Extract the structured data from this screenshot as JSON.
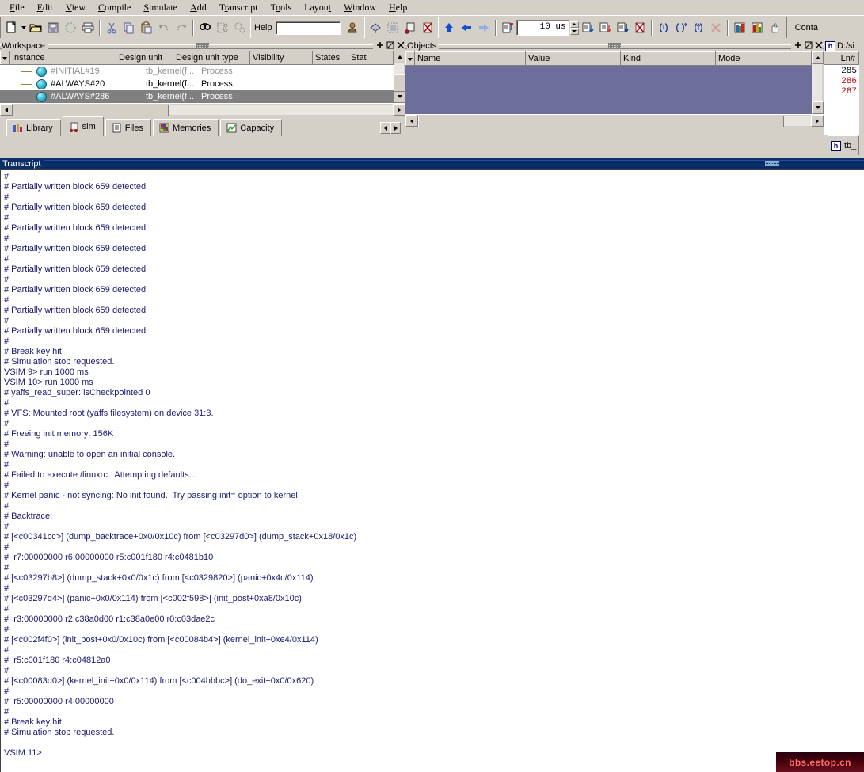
{
  "menu": {
    "items": [
      "File",
      "Edit",
      "View",
      "Compile",
      "Simulate",
      "Add",
      "Transcript",
      "Tools",
      "Layout",
      "Window",
      "Help"
    ]
  },
  "toolbar": {
    "help_label": "Help",
    "help_value": "",
    "run_length": "10 us",
    "icons_file": [
      "new-document-icon",
      "open-folder-icon",
      "save-icon",
      "reload-icon",
      "print-icon"
    ],
    "icons_edit": [
      "cut-icon",
      "copy-icon",
      "paste-icon",
      "undo-icon",
      "redo-icon"
    ],
    "icons_find": [
      "find-icon",
      "find-next-icon",
      "find-in-files-icon"
    ],
    "icons_wave": [
      "compile-icon",
      "compile-all-icon",
      "simulate-icon",
      "break-icon"
    ],
    "icons_sim": [
      "step-up-icon",
      "step-back-icon",
      "step-forward-icon"
    ],
    "icons_run": [
      "restart-icon",
      "run-icon",
      "continue-run-icon",
      "run-all-icon",
      "break-stop-icon"
    ],
    "icons_step": [
      "step-icon",
      "step-over-icon",
      "step-out-icon",
      "stop-icon"
    ],
    "icons_profile": [
      "profile-icon",
      "memory-icon",
      "hand-icon"
    ],
    "context_label": "Conta"
  },
  "workspace": {
    "title": "Workspace",
    "columns": [
      "Instance",
      "Design unit",
      "Design unit type",
      "Visibility",
      "States",
      "Stat"
    ],
    "rows": [
      {
        "instance": "#INITIAL#19",
        "design_unit": "tb_kernel(f...",
        "design_unit_type": "Process",
        "state": "dim"
      },
      {
        "instance": "#ALWAYS#20",
        "design_unit": "tb_kernel(f...",
        "design_unit_type": "Process",
        "state": "normal"
      },
      {
        "instance": "#ALWAYS#286",
        "design_unit": "tb_kernel(f...",
        "design_unit_type": "Process",
        "state": "selected"
      }
    ],
    "tabs": [
      {
        "label": "Library",
        "icon": "library-icon",
        "active": false
      },
      {
        "label": "sim",
        "icon": "sim-icon",
        "active": true
      },
      {
        "label": "Files",
        "icon": "files-icon",
        "active": false
      },
      {
        "label": "Memories",
        "icon": "memories-icon",
        "active": false
      },
      {
        "label": "Capacity",
        "icon": "capacity-icon",
        "active": false
      }
    ]
  },
  "objects": {
    "title": "Objects",
    "columns": [
      "Name",
      "Value",
      "Kind",
      "Mode"
    ],
    "rows": []
  },
  "source": {
    "title": "D:/si",
    "column_header": "Ln#",
    "lines": [
      {
        "number": "285",
        "breakpoint": false
      },
      {
        "number": "286",
        "breakpoint": true
      },
      {
        "number": "287",
        "breakpoint": true
      }
    ],
    "tab_label": "tb_"
  },
  "transcript": {
    "title": "Transcript",
    "lines": [
      "#",
      "# Partially written block 659 detected",
      "#",
      "# Partially written block 659 detected",
      "#",
      "# Partially written block 659 detected",
      "#",
      "# Partially written block 659 detected",
      "#",
      "# Partially written block 659 detected",
      "#",
      "# Partially written block 659 detected",
      "#",
      "# Partially written block 659 detected",
      "#",
      "# Partially written block 659 detected",
      "#",
      "# Break key hit",
      "# Simulation stop requested.",
      "VSIM 9> run 1000 ms",
      "VSIM 10> run 1000 ms",
      "# yaffs_read_super: isCheckpointed 0",
      "#",
      "# VFS: Mounted root (yaffs filesystem) on device 31:3.",
      "#",
      "# Freeing init memory: 156K",
      "#",
      "# Warning: unable to open an initial console.",
      "#",
      "# Failed to execute /linuxrc.  Attempting defaults...",
      "#",
      "# Kernel panic - not syncing: No init found.  Try passing init= option to kernel.",
      "#",
      "# Backtrace:",
      "#",
      "# [<c00341cc>] (dump_backtrace+0x0/0x10c) from [<c03297d0>] (dump_stack+0x18/0x1c)",
      "#",
      "#  r7:00000000 r6:00000000 r5:c001f180 r4:c0481b10",
      "#",
      "# [<c03297b8>] (dump_stack+0x0/0x1c) from [<c0329820>] (panic+0x4c/0x114)",
      "#",
      "# [<c03297d4>] (panic+0x0/0x114) from [<c002f598>] (init_post+0xa8/0x10c)",
      "#",
      "#  r3:00000000 r2:c38a0d00 r1:c38a0e00 r0:c03dae2c",
      "#",
      "# [<c002f4f0>] (init_post+0x0/0x10c) from [<c00084b4>] (kernel_init+0xe4/0x114)",
      "#",
      "#  r5:c001f180 r4:c04812a0",
      "#",
      "# [<c00083d0>] (kernel_init+0x0/0x114) from [<c004bbbc>] (do_exit+0x0/0x620)",
      "#",
      "#  r5:00000000 r4:00000000",
      "#",
      "# Break key hit",
      "# Simulation stop requested.",
      "",
      "VSIM 11>"
    ]
  },
  "watermark": {
    "text": "bbs.eetop.cn"
  },
  "panel_buttons": {
    "dock": "dock-icon",
    "undock": "undock-icon",
    "close": "close-icon"
  }
}
